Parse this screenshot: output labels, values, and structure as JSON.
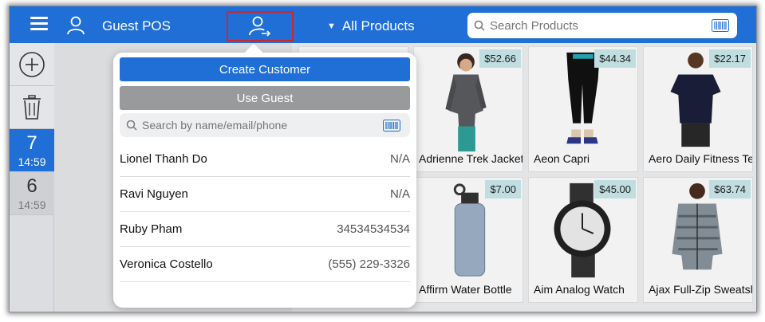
{
  "header": {
    "pos_title": "Guest POS",
    "category": "All Products",
    "search_placeholder": "Search Products",
    "accent_color": "#1f6fd6",
    "highlight_color": "#d3242b"
  },
  "rail": {
    "orders": [
      {
        "number": "7",
        "time": "14:59",
        "active": true
      },
      {
        "number": "6",
        "time": "14:59",
        "active": false
      }
    ]
  },
  "popover": {
    "create_label": "Create Customer",
    "guest_label": "Use Guest",
    "search_placeholder": "Search by name/email/phone",
    "customers": [
      {
        "name": "Lionel Thanh Do",
        "phone": "N/A"
      },
      {
        "name": "Ravi Nguyen",
        "phone": "N/A"
      },
      {
        "name": "Ruby Pham",
        "phone": "34534534534"
      },
      {
        "name": "Veronica Costello",
        "phone": "(555) 229-3326"
      }
    ]
  },
  "products": [
    {
      "name": "Adrienne Trek Jacket",
      "price": "$52.66",
      "icon": "jacket-image"
    },
    {
      "name": "Aeon Capri",
      "price": "$44.34",
      "icon": "capri-image"
    },
    {
      "name": "Aero Daily Fitness Tee",
      "price": "$22.17",
      "icon": "tee-image"
    },
    {
      "name": "Affirm Water Bottle",
      "price": "$7.00",
      "icon": "bottle-image"
    },
    {
      "name": "Aim Analog Watch",
      "price": "$45.00",
      "icon": "watch-image"
    },
    {
      "name": "Ajax Full-Zip Sweatshirt",
      "price": "$63.74",
      "icon": "sweatshirt-image"
    }
  ]
}
